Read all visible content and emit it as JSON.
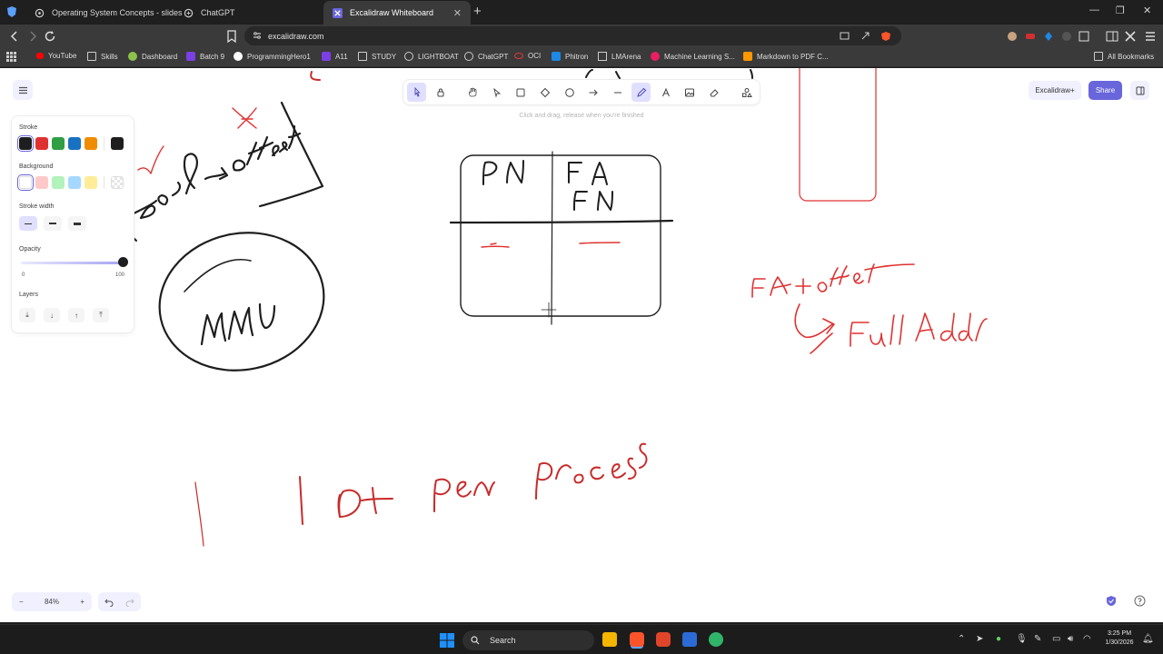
{
  "browser": {
    "tabs": [
      {
        "title": "Operating System Concepts - slides",
        "icon": "gear-globe-icon",
        "active": false
      },
      {
        "title": "ChatGPT",
        "icon": "chatgpt-icon",
        "active": false
      },
      {
        "title": "Excalidraw Whiteboard",
        "icon": "excalidraw-icon",
        "active": true
      }
    ],
    "new_tab": "+",
    "url": "excalidraw.com",
    "bookmarks": [
      {
        "label": "YouTube",
        "icon": "youtube-icon",
        "color": "#ff0000"
      },
      {
        "label": "Skills",
        "icon": "folder-icon",
        "color": "#cccccc"
      },
      {
        "label": "Dashboard",
        "icon": "dashboard-icon",
        "color": "#8bc34a"
      },
      {
        "label": "Batch 9",
        "icon": "p-icon",
        "color": "#7b3fe4"
      },
      {
        "label": "ProgrammingHero1",
        "icon": "github-icon",
        "color": "#ffffff"
      },
      {
        "label": "A11",
        "icon": "p-icon",
        "color": "#7b3fe4"
      },
      {
        "label": "STUDY",
        "icon": "folder-icon",
        "color": "#cccccc"
      },
      {
        "label": "LIGHTBOAT",
        "icon": "globe-icon",
        "color": "#cccccc"
      },
      {
        "label": "ChatGPT",
        "icon": "chatgpt-icon",
        "color": "#cccccc"
      },
      {
        "label": "OCI",
        "icon": "oracle-icon",
        "color": "#e53935"
      },
      {
        "label": "Phitron",
        "icon": "phitron-icon",
        "color": "#1e88e5"
      },
      {
        "label": "LMArena",
        "icon": "document-icon",
        "color": "#cccccc"
      },
      {
        "label": "Machine Learning S...",
        "icon": "ml-icon",
        "color": "#e91e63"
      },
      {
        "label": "Markdown to PDF C...",
        "icon": "markdown-icon",
        "color": "#ff9800"
      }
    ],
    "all_bookmarks": "All Bookmarks"
  },
  "excalidraw": {
    "toolbar_hint": "Click and drag, release when you're finished",
    "excalidraw_plus": "Excalidraw+",
    "share": "Share",
    "properties": {
      "stroke_label": "Stroke",
      "stroke_colors": [
        "#1e1e1e",
        "#e03131",
        "#2f9e44",
        "#1971c2",
        "#f08c00"
      ],
      "stroke_current": "#1e1e1e",
      "background_label": "Background",
      "background_colors": [
        "transparent",
        "#ffc9c9",
        "#b2f2bb",
        "#a5d8ff",
        "#ffec99"
      ],
      "stroke_width_label": "Stroke width",
      "opacity_label": "Opacity",
      "opacity_min": "0",
      "opacity_max": "100",
      "opacity_value": 100,
      "layers_label": "Layers"
    },
    "zoom": "84%",
    "zoom_minus": "−",
    "zoom_plus": "+"
  },
  "taskbar": {
    "search": "Search",
    "time": "3:25 PM",
    "date": "1/30/2026"
  }
}
